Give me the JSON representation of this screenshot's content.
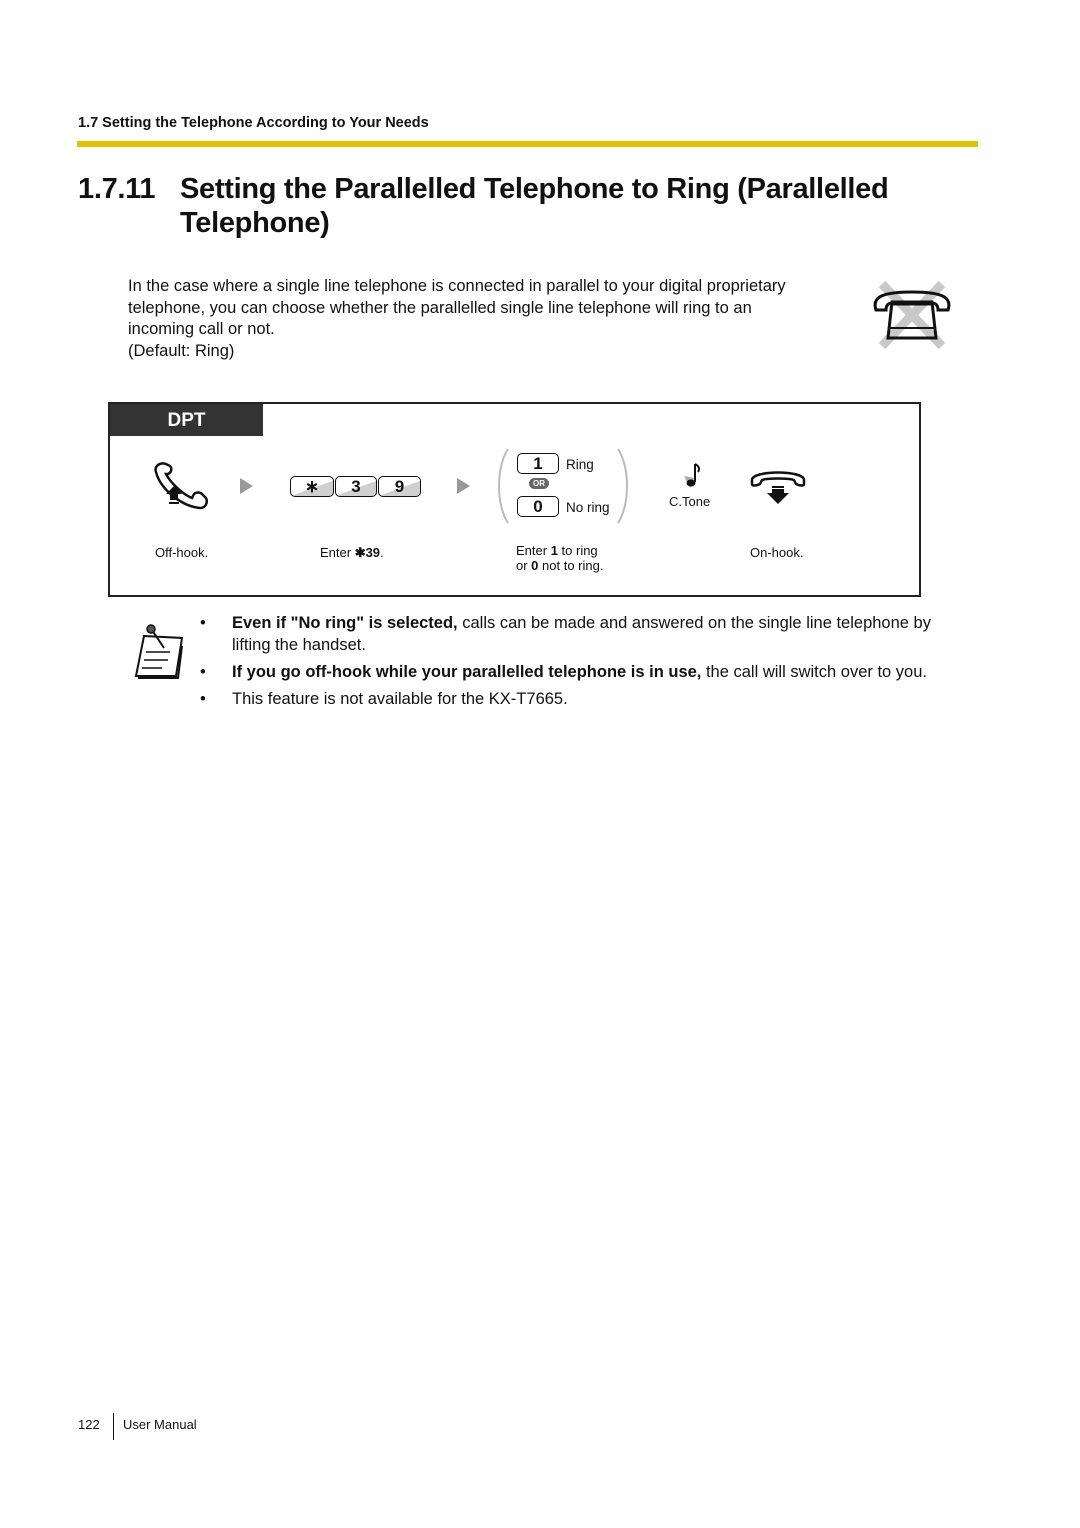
{
  "header": {
    "section": "1.7 Setting the Telephone According to Your Needs",
    "rule_color": "#dfc400"
  },
  "title": {
    "number": "1.7.11",
    "text": "Setting the Parallelled Telephone to Ring (Parallelled Telephone)"
  },
  "intro": {
    "lines": [
      "In the case where a single line telephone is connected in parallel to your digital proprietary",
      "telephone, you can choose whether the parallelled single line telephone will ring to an",
      "incoming call or not.",
      "(Default: Ring)"
    ],
    "icon": "single-line-telephone-crossed-icon"
  },
  "procedure": {
    "tab_label": "DPT",
    "steps": {
      "off_hook": {
        "label": "Off-hook.",
        "icon": "handset-off-hook-icon"
      },
      "enter_code": {
        "keys": [
          "∗",
          "3",
          "9"
        ],
        "label_prefix": "Enter ",
        "label_code": "✱39",
        "label_suffix": "."
      },
      "choose": {
        "options": [
          {
            "key": "1",
            "label": "Ring"
          },
          {
            "key": "0",
            "label": "No ring"
          }
        ],
        "or_label": "OR",
        "label_line1_a": "Enter ",
        "label_line1_b": "1",
        "label_line1_c": " to ring",
        "label_line2_a": "or ",
        "label_line2_b": "0",
        "label_line2_c": " not to ring."
      },
      "confirm": {
        "label": "C.Tone",
        "icon": "confirmation-tone-icon"
      },
      "on_hook": {
        "label": "On-hook.",
        "icon": "handset-on-hook-icon"
      }
    }
  },
  "notes": {
    "icon": "notepad-icon",
    "items": [
      {
        "bold": "Even if \"No ring\" is selected,",
        "text": " calls can be made and answered on the single line telephone by lifting the handset."
      },
      {
        "bold": "If you go off-hook while your parallelled telephone is in use,",
        "text": " the call will switch over to you."
      },
      {
        "bold": "",
        "text": "This feature is not available for the KX-T7665."
      }
    ]
  },
  "footer": {
    "page_number": "122",
    "label": "User Manual"
  }
}
